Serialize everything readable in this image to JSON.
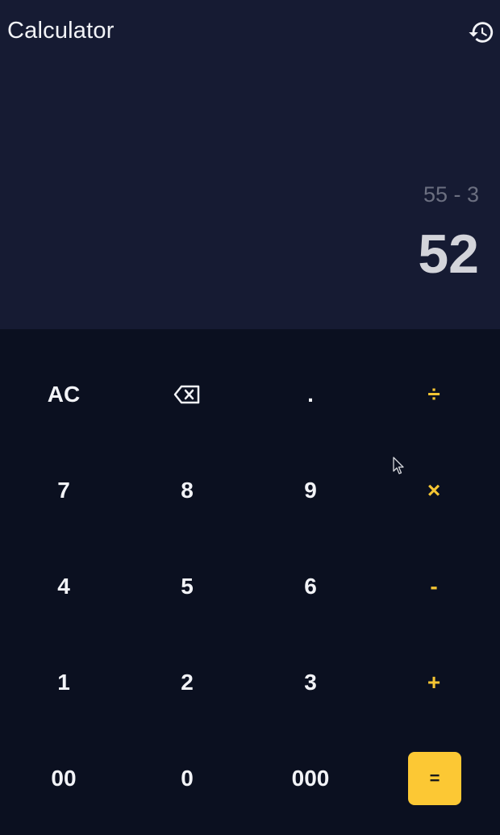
{
  "app": {
    "title": "Calculator"
  },
  "display": {
    "expression": "55 - 3",
    "result": "52"
  },
  "icons": {
    "history": "history-icon",
    "backspace": "backspace-icon"
  },
  "keys": {
    "ac": "AC",
    "dot": ".",
    "divide": "÷",
    "seven": "7",
    "eight": "8",
    "nine": "9",
    "multiply": "×",
    "four": "4",
    "five": "5",
    "six": "6",
    "minus": "-",
    "one": "1",
    "two": "2",
    "three": "3",
    "plus": "+",
    "double_zero": "00",
    "zero": "0",
    "triple_zero": "000",
    "equals": "="
  },
  "colors": {
    "display_bg": "#161b33",
    "keypad_bg": "#0b1020",
    "accent": "#fcc834"
  }
}
